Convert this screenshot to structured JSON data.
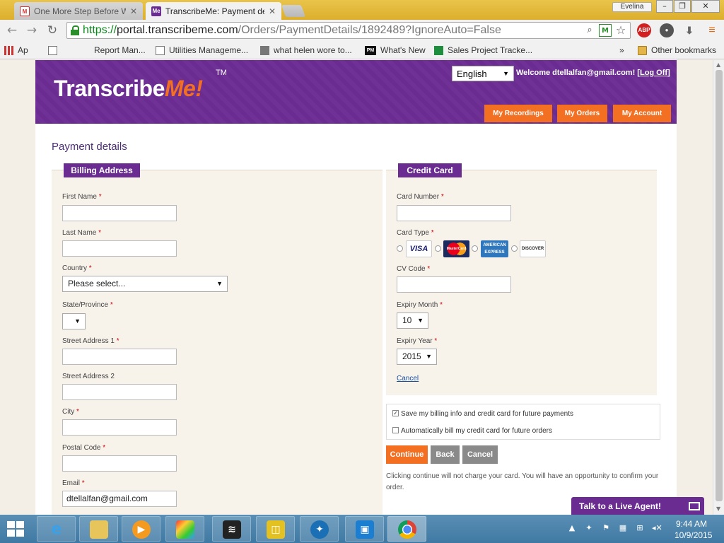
{
  "browser": {
    "tabs": [
      {
        "label": "One More Step Before We",
        "favicon": "gmail-icon",
        "active": false
      },
      {
        "label": "TranscribeMe: Payment de",
        "favicon": "transcribeme-favicon",
        "active": true
      }
    ],
    "profile_name": "Evelina",
    "url": {
      "scheme": "https://",
      "host": "portal.transcribeme.com",
      "path": "/Orders/PaymentDetails/1892489?IgnoreAuto=False"
    },
    "extensions": [
      "search-icon",
      "translate-shield-icon",
      "star-icon",
      "adblock-icon",
      "film-reel-icon",
      "download-icon",
      "menu-icon"
    ],
    "adblock_label": "ABP",
    "bookmarks": [
      {
        "label": "Ap",
        "icon": "apps-grid-icon"
      },
      {
        "label": "Report Man...",
        "icon": "page-icon"
      },
      {
        "label": "Utilities Manageme...",
        "icon": "page-icon"
      },
      {
        "label": "what helen wore to...",
        "icon": "cube-icon"
      },
      {
        "label": "What's New",
        "icon": "pm-icon"
      },
      {
        "label": "Sales Project Tracke...",
        "icon": "sheets-icon"
      }
    ],
    "bookmarks_overflow": "»",
    "other_bookmarks": "Other bookmarks",
    "pm_badge": "PM"
  },
  "header": {
    "logo_text": "Transcribe",
    "logo_accent": "Me!",
    "logo_tm": "TM",
    "language": "English",
    "welcome_prefix": "Welcome dtellalfan@gmail.com!",
    "logoff_open": "[",
    "logoff_label": "Log Off",
    "logoff_close": "]",
    "nav": [
      "My Recordings",
      "My Orders",
      "My Account"
    ]
  },
  "page": {
    "title": "Payment details",
    "billing": {
      "header": "Billing Address",
      "fields": {
        "first_name": {
          "label": "First Name",
          "value": ""
        },
        "last_name": {
          "label": "Last Name",
          "value": ""
        },
        "country": {
          "label": "Country",
          "value": "Please select..."
        },
        "state": {
          "label": "State/Province",
          "value": ""
        },
        "street1": {
          "label": "Street Address 1",
          "value": ""
        },
        "street2": {
          "label": "Street Address 2",
          "value": ""
        },
        "city": {
          "label": "City",
          "value": ""
        },
        "postal": {
          "label": "Postal Code",
          "value": ""
        },
        "email": {
          "label": "Email",
          "value": "dtellalfan@gmail.com"
        }
      }
    },
    "credit_card": {
      "header": "Credit Card",
      "card_number_label": "Card Number",
      "card_type_label": "Card Type",
      "card_types": [
        "VISA",
        "MasterCard",
        "AMERICAN EXPRESS",
        "DISCOVER"
      ],
      "cv_label": "CV Code",
      "expiry_month_label": "Expiry Month",
      "expiry_month": "10",
      "expiry_year_label": "Expiry Year",
      "expiry_year": "2015",
      "cancel_link": "Cancel"
    },
    "required_mark": "*",
    "options": {
      "save_billing": {
        "label": "Save my billing info and credit card for future payments",
        "checked": true
      },
      "auto_bill": {
        "label": "Automatically bill my credit card for future orders",
        "checked": false
      }
    },
    "buttons": {
      "continue": "Continue",
      "back": "Back",
      "cancel": "Cancel"
    },
    "note": "Clicking continue will not charge your card. You will have an opportunity to confirm your order.",
    "live_agent": "Talk to a Live Agent!"
  },
  "taskbar": {
    "time": "9:44 AM",
    "date": "10/9/2015"
  },
  "colors": {
    "brand_purple": "#6a2c91",
    "brand_orange": "#f36f21",
    "button_gray": "#8a8a8a",
    "omnibox_green": "#0a8a1a"
  }
}
